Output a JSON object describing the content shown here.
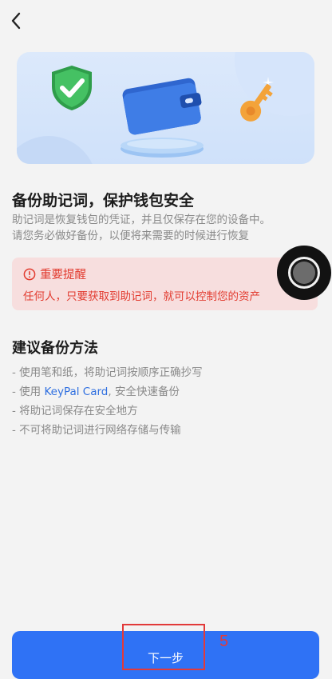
{
  "header": {
    "back_icon": "chevron-left-icon"
  },
  "hero": {
    "icons": [
      "shield-check-icon",
      "wallet-icon",
      "key-icon"
    ]
  },
  "intro": {
    "title": "备份助记词，保护钱包安全",
    "desc_line1": "助记词是恢复钱包的凭证，并且仅保存在您的设备中。",
    "desc_line2": "请您务必做好备份，以便将来需要的时候进行恢复"
  },
  "warning": {
    "title": "重要提醒",
    "text": "任何人，只要获取到助记词，就可以控制您的资产",
    "color": "#e23b2f"
  },
  "methods": {
    "title": "建议备份方法",
    "tip1": "- 使用笔和纸，将助记词按顺序正确抄写",
    "tip2_prefix": "- 使用 ",
    "tip2_link": "KeyPal Card",
    "tip2_suffix": ", 安全快速备份",
    "tip3": "- 将助记词保存在安全地方",
    "tip4": "- 不可将助记词进行网络存储与传输"
  },
  "footer": {
    "next_label": "下一步",
    "accent": "#2f72f5"
  },
  "annotation": {
    "number": "5"
  }
}
